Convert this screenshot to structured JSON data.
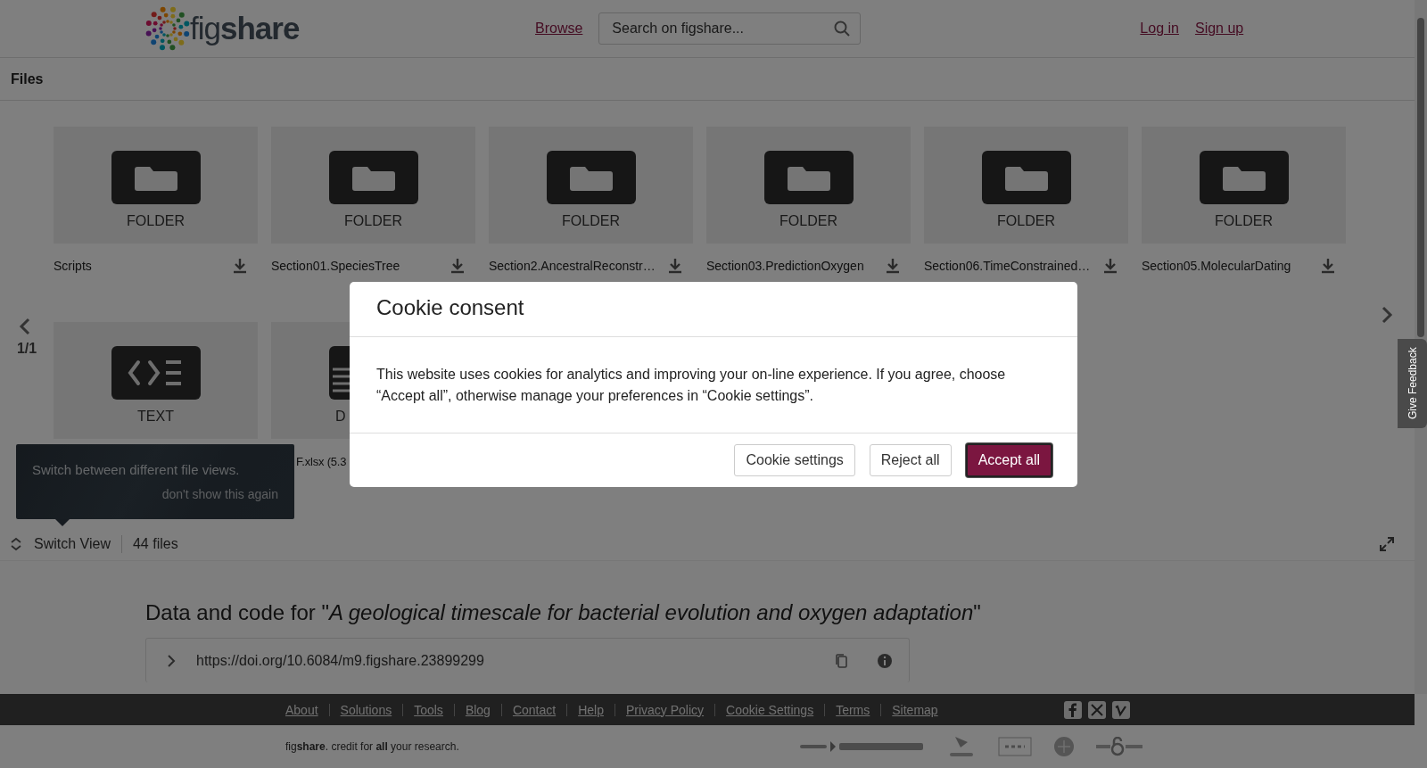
{
  "header": {
    "logo": "fig**share**",
    "nav_link": "Browse",
    "search": {
      "placeholder": "Search on figshare..."
    },
    "account_links": [
      "Log in",
      "Sign up"
    ]
  },
  "files_bar": {
    "title": "Files"
  },
  "pager": "1/1",
  "file_rows": [
    {
      "items": [
        {
          "kind": "folder",
          "type_label": "FOLDER",
          "name": "Scripts"
        },
        {
          "kind": "folder",
          "type_label": "FOLDER",
          "name": "Section01.SpeciesTree"
        },
        {
          "kind": "folder",
          "type_label": "FOLDER",
          "name": "Section2.AncestralReconstr…"
        },
        {
          "kind": "folder",
          "type_label": "FOLDER",
          "name": "Section03.PredictionOxygen"
        },
        {
          "kind": "folder",
          "type_label": "FOLDER",
          "name": "Section06.TimeConstrained…"
        },
        {
          "kind": "folder",
          "type_label": "FOLDER",
          "name": "Section05.MolecularDating"
        }
      ]
    },
    {
      "items": [
        {
          "kind": "text",
          "type_label": "TEXT"
        },
        {
          "kind": "data",
          "type_label": "D",
          "name": "F.xlsx (5.3"
        }
      ]
    }
  ],
  "tooltip": {
    "message": "Switch between different file views.",
    "dismiss": "don't show this again"
  },
  "view_bar": {
    "switch_label": "Switch View",
    "count": "44 files"
  },
  "item": {
    "title": "Data and code for \"*A geological timescale for bacterial evolution and oxygen adaptation*\"",
    "doi": "https://doi.org/10.6084/m9.figshare.23899299"
  },
  "footer": {
    "links": [
      "About",
      "Solutions",
      "Tools",
      "Blog",
      "Contact",
      "Help",
      "Privacy Policy",
      "Cookie Settings",
      "Terms",
      "Sitemap"
    ],
    "tagline": "fig**share**. credit for **all** your research."
  },
  "feedback_tab": "Give Feedback",
  "cookie_dialog": {
    "title": "Cookie consent",
    "body": "This website uses cookies for analytics and improving your on-line experience. If you agree, choose “Accept all”, otherwise manage your preferences in “Cookie settings”.",
    "buttons": [
      {
        "label": "Cookie settings",
        "primary": false
      },
      {
        "label": "Reject all",
        "primary": false
      },
      {
        "label": "Accept all",
        "primary": true
      }
    ]
  }
}
